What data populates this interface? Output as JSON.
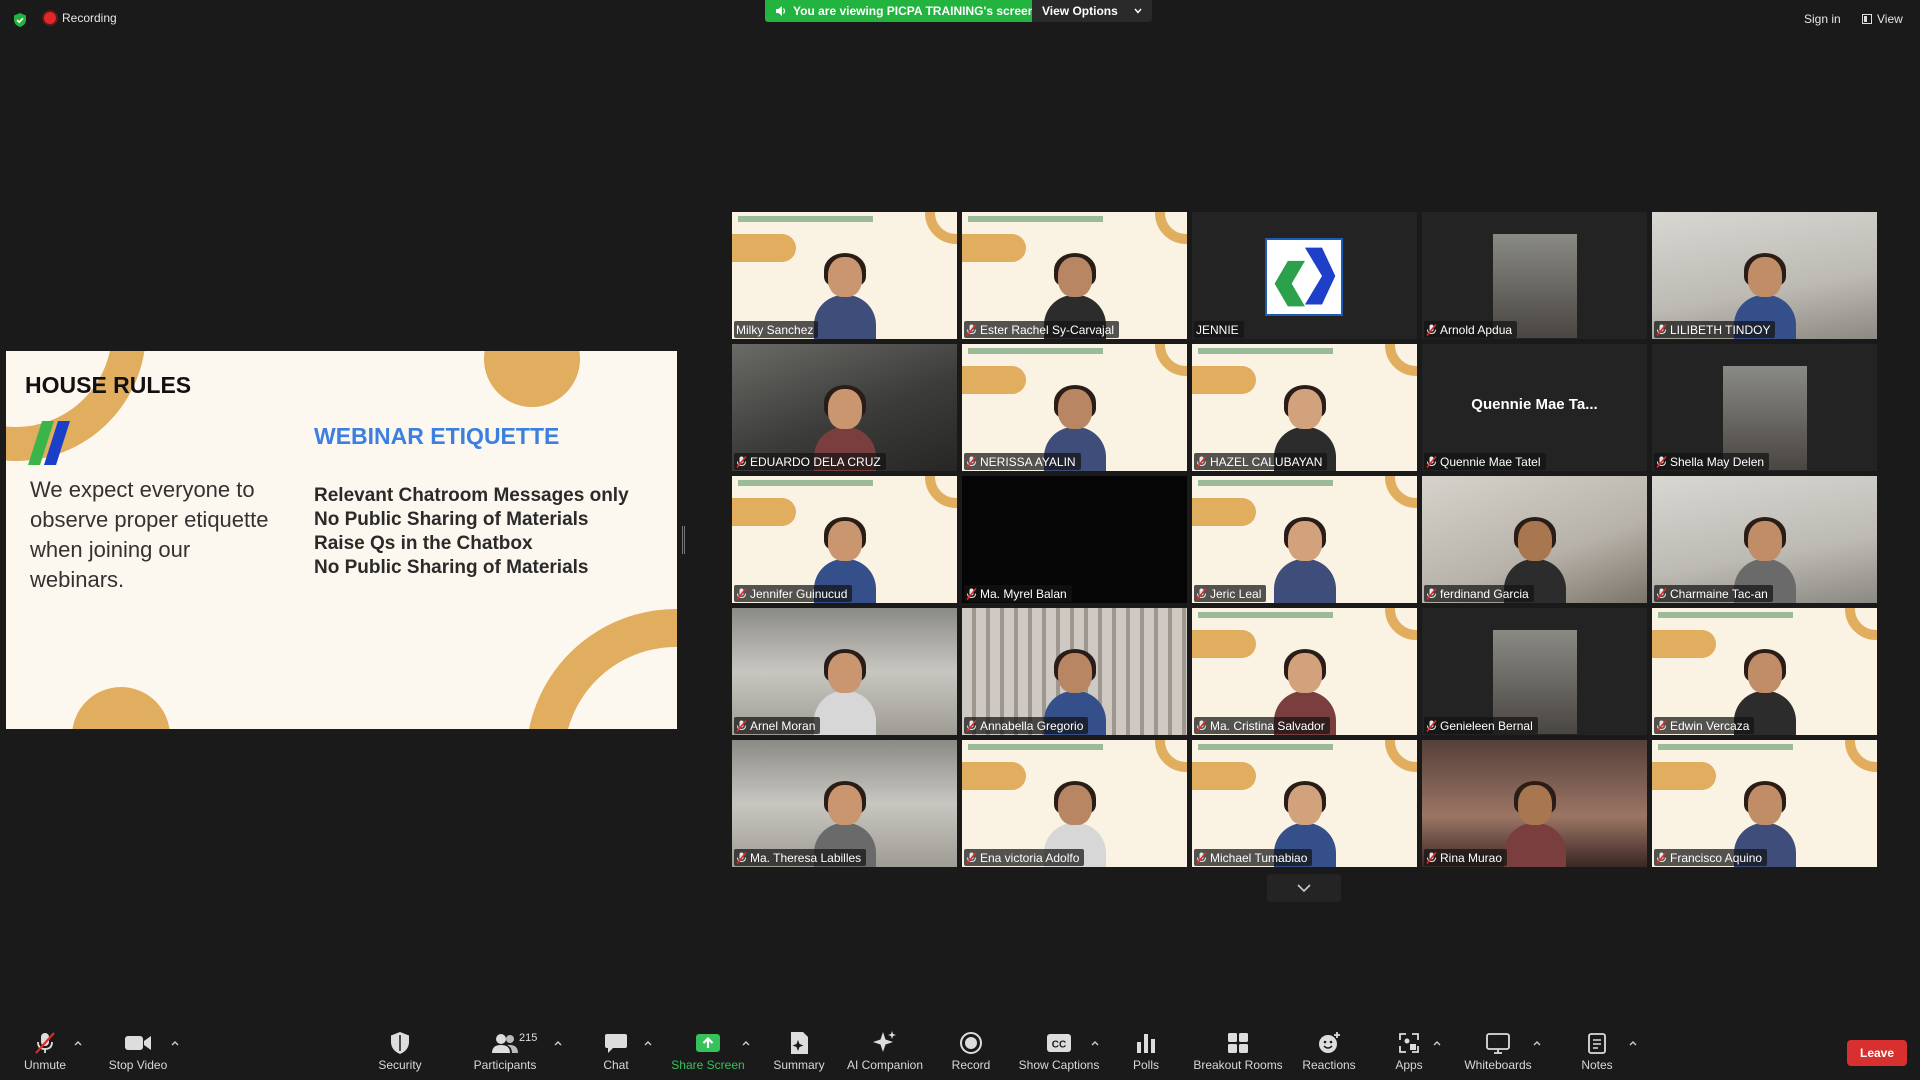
{
  "topbar": {
    "recording_label": "Recording",
    "viewing_banner": "You are viewing PICPA TRAINING's screen",
    "view_options_label": "View Options",
    "sign_in_label": "Sign in",
    "view_label": "View"
  },
  "slide": {
    "title": "HOUSE RULES",
    "left_text": "We expect everyone to observe proper etiquette when joining our webinars.",
    "etiquette_title": "WEBINAR ETIQUETTE",
    "rules": [
      "Relevant Chatroom Messages only",
      "No Public Sharing of Materials",
      "Raise Qs in the Chatbox",
      "No Public Sharing of Materials"
    ]
  },
  "participants": [
    {
      "name": "Milky Sanchez",
      "muted": false
    },
    {
      "name": "Ester Rachel Sy-Carvajal",
      "muted": true
    },
    {
      "name": "JENNIE",
      "muted": false
    },
    {
      "name": "Arnold Apdua",
      "muted": true
    },
    {
      "name": "LILIBETH TINDOY",
      "muted": true
    },
    {
      "name": "EDUARDO DELA CRUZ",
      "muted": true
    },
    {
      "name": "NERISSA AYALIN",
      "muted": true
    },
    {
      "name": "HAZEL CALUBAYAN",
      "muted": true
    },
    {
      "name": "Quennie Mae Tatel",
      "muted": true,
      "display_name": "Quennie Mae Ta..."
    },
    {
      "name": "Shella May Delen",
      "muted": true
    },
    {
      "name": "Jennifer Guinucud",
      "muted": true
    },
    {
      "name": "Ma. Myrel Balan",
      "muted": true
    },
    {
      "name": "Jeric Leal",
      "muted": true
    },
    {
      "name": "ferdinand Garcia",
      "muted": true
    },
    {
      "name": "Charmaine Tac-an",
      "muted": true
    },
    {
      "name": "Arnel Moran",
      "muted": true
    },
    {
      "name": "Annabella Gregorio",
      "muted": true
    },
    {
      "name": "Ma. Cristina Salvador",
      "muted": true
    },
    {
      "name": "Genieleen Bernal",
      "muted": true
    },
    {
      "name": "Edwin Vercaza",
      "muted": true
    },
    {
      "name": "Ma. Theresa Labilles",
      "muted": true
    },
    {
      "name": "Ena victoria Adolfo",
      "muted": true
    },
    {
      "name": "Michael Tumabiao",
      "muted": true
    },
    {
      "name": "Rina Murao",
      "muted": true
    },
    {
      "name": "Francisco Aquino",
      "muted": true
    }
  ],
  "toolbar": {
    "unmute": "Unmute",
    "stop_video": "Stop Video",
    "security": "Security",
    "participants": "Participants",
    "participants_count": "215",
    "chat": "Chat",
    "share_screen": "Share Screen",
    "summary": "Summary",
    "ai_companion": "AI Companion",
    "record": "Record",
    "show_captions": "Show Captions",
    "cc": "CC",
    "polls": "Polls",
    "breakout_rooms": "Breakout Rooms",
    "reactions": "Reactions",
    "apps": "Apps",
    "whiteboards": "Whiteboards",
    "notes": "Notes",
    "leave": "Leave"
  },
  "colors": {
    "share_green": "#23b33f",
    "leave_red": "#d8302f",
    "slide_gold": "#e1ad5e",
    "etiquette_blue": "#3b7fe0",
    "active_speaker": "#b6d34b"
  }
}
